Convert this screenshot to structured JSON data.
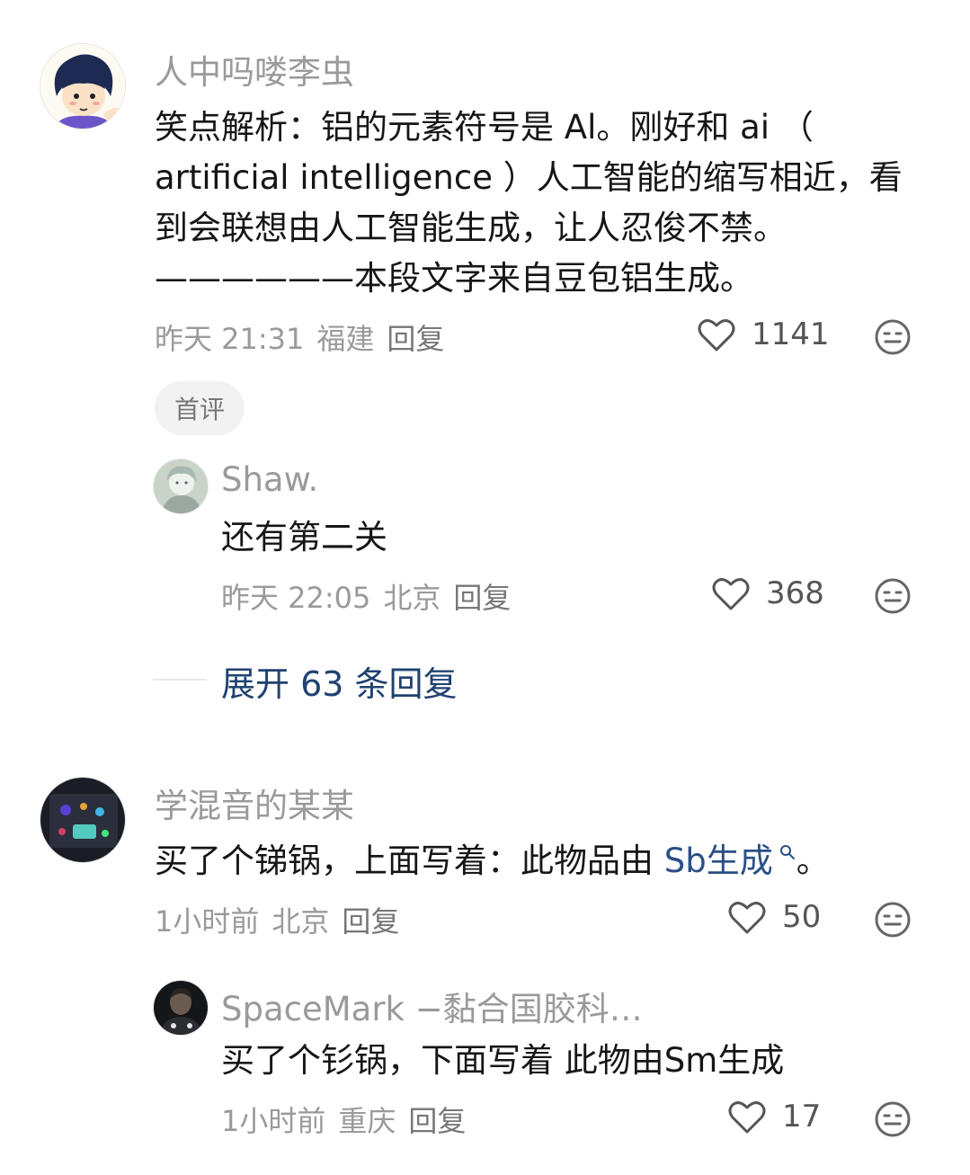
{
  "comments": [
    {
      "user": "人中吗喽李虫",
      "text": "笑点解析：铝的元素符号是 Al。刚好和 ai （ artificial intelligence ）人工智能的缩写相近，看到会联想由人工智能生成，让人忍俊不禁。——————本段文字来自豆包铝生成。",
      "time": "昨天 21:31",
      "location": "福建",
      "reply_label": "回复",
      "likes": "1141",
      "tag": "首评",
      "replies": [
        {
          "user": "Shaw.",
          "text": "还有第二关",
          "time": "昨天 22:05",
          "location": "北京",
          "reply_label": "回复",
          "likes": "368"
        }
      ],
      "expand_label": "展开 63 条回复"
    },
    {
      "user": "学混音的某某",
      "text_prefix": "买了个锑锅，上面写着：此物品由 ",
      "text_link": "Sb生成",
      "text_suffix": "。",
      "time": "1小时前",
      "location": "北京",
      "reply_label": "回复",
      "likes": "50",
      "replies": [
        {
          "user": "SpaceMark −黏合国胶科…",
          "text": "买了个钐锅，下面写着 此物由Sm生成",
          "time": "1小时前",
          "location": "重庆",
          "reply_label": "回复",
          "likes": "17"
        }
      ]
    }
  ],
  "icons": {
    "like": "heart-outline-icon",
    "emoji": "neutral-face-icon",
    "search": "search-icon"
  },
  "colors": {
    "link": "#2a4f86",
    "expand": "#1f4270",
    "meta": "#9a9a9a"
  }
}
